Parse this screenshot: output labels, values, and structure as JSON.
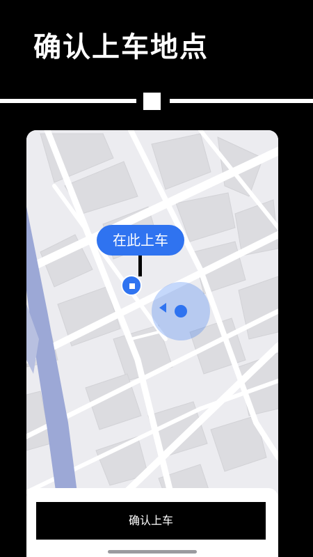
{
  "headline": "确认上车地点",
  "map": {
    "pickup_label": "在此上车"
  },
  "confirm_button_label": "确认上车",
  "colors": {
    "accent": "#2f73f0",
    "background": "#000000",
    "map_block": "#dcdce0",
    "road": "#ffffff",
    "river": "#9ca8d6"
  },
  "icons": {
    "pickup_pin": "pickup-pin-icon",
    "location": "current-location-icon"
  }
}
